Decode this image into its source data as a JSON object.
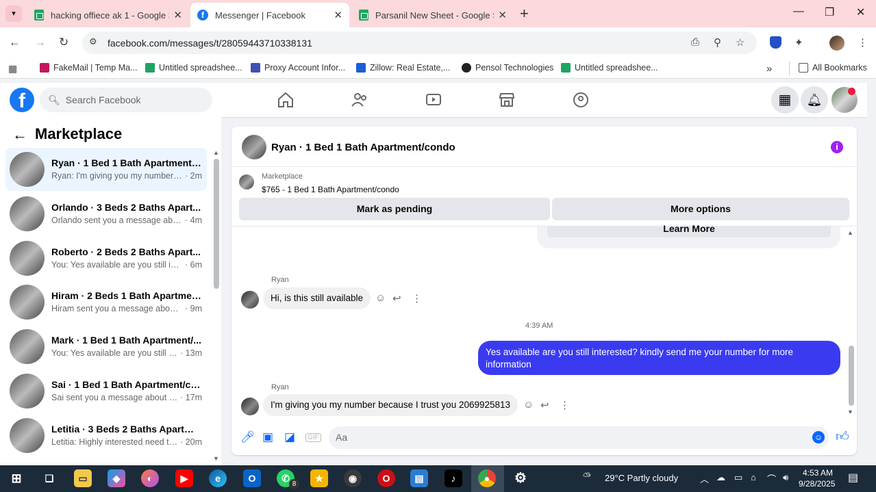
{
  "browser": {
    "tabs": [
      {
        "title": "hacking offiece ak 1 - Google Sh",
        "icon": "sheets-icon"
      },
      {
        "title": "Messenger | Facebook",
        "icon": "facebook-icon"
      },
      {
        "title": "Parsanil New Sheet - Google Sh",
        "icon": "sheets-icon"
      }
    ],
    "close_glyph": "✕",
    "new_tab_glyph": "+",
    "url": "facebook.com/messages/t/28059443710338131",
    "bookmarks": [
      {
        "label": "FakeMail | Temp Ma...",
        "color": "#c2185b"
      },
      {
        "label": "Untitled spreadshee...",
        "color": "#1fa463"
      },
      {
        "label": "Proxy Account Infor...",
        "color": "#3f51b5"
      },
      {
        "label": "Zillow: Real Estate,...",
        "color": "#1a5fd6"
      },
      {
        "label": "Pensol Technologies",
        "color": "#222222"
      },
      {
        "label": "Untitled spreadshee...",
        "color": "#1fa463"
      }
    ],
    "all_bookmarks": "All Bookmarks",
    "more_glyph": "»"
  },
  "facebook": {
    "search_placeholder": "Search Facebook"
  },
  "sidebar": {
    "title": "Marketplace",
    "conversations": [
      {
        "name": "Ryan · 1 Bed 1 Bath Apartment/c...",
        "preview": "Ryan: I'm giving you my number b...",
        "time": "· 2m",
        "selected": true
      },
      {
        "name": "Orlando · 3 Beds 2 Baths Apart...",
        "preview": "Orlando sent you a message abou...",
        "time": "· 4m"
      },
      {
        "name": "Roberto · 2 Beds 2 Baths Apart...",
        "preview": "You: Yes available are you still inter...",
        "time": "· 6m"
      },
      {
        "name": "Hiram · 2 Beds 1 Bath Apartmen...",
        "preview": "Hiram sent you a message about y...",
        "time": "· 9m"
      },
      {
        "name": "Mark · 1 Bed 1 Bath Apartment/...",
        "preview": "You: Yes available are you still int...",
        "time": "· 13m"
      },
      {
        "name": "Sai · 1 Bed 1 Bath Apartment/co...",
        "preview": "Sai sent you a message about yo...",
        "time": "· 17m"
      },
      {
        "name": "Letitia · 3 Beds 2 Baths Apartme...",
        "preview": "Letitia: Highly interested need to ...",
        "time": "· 20m"
      }
    ]
  },
  "chat": {
    "header_name": "Ryan · 1 Bed 1 Bath Apartment/condo",
    "info_glyph": "i",
    "listing_label": "Marketplace",
    "listing_price": "$765 - 1 Bed 1 Bath Apartment/condo",
    "mark_pending": "Mark as pending",
    "more_options": "More options",
    "learn_more": "Learn More",
    "messages": [
      {
        "sender": "Ryan",
        "text": "Hi, is this still available"
      },
      {
        "timestamp": "4:39 AM"
      },
      {
        "text": "Yes available are you still interested? kindly send me your number for more information",
        "outgoing": true
      },
      {
        "sender": "Ryan",
        "text": "I'm giving you my number because I trust you 2069925813"
      }
    ],
    "compose_placeholder": "Aa"
  },
  "taskbar": {
    "weather": "29°C  Partly cloudy",
    "time": "4:53 AM",
    "date": "9/28/2025",
    "whatsapp_badge": "8"
  }
}
